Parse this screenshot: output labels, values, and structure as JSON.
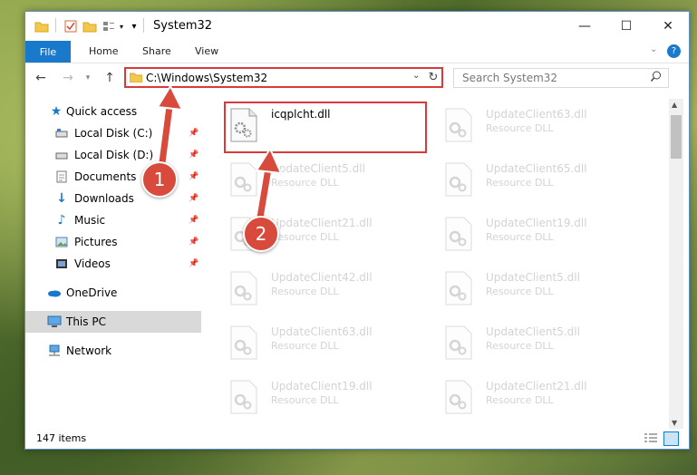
{
  "window": {
    "title": "System32"
  },
  "ribbon": {
    "file": "File",
    "tabs": [
      "Home",
      "Share",
      "View"
    ]
  },
  "address": {
    "path": "C:\\Windows\\System32"
  },
  "search": {
    "placeholder": "Search System32"
  },
  "sidebar": {
    "quick_access": "Quick access",
    "items": [
      {
        "label": "Local Disk (C:)",
        "icon": "drive-icon"
      },
      {
        "label": "Local Disk (D:)",
        "icon": "drive-icon"
      },
      {
        "label": "Documents",
        "icon": "documents-icon"
      },
      {
        "label": "Downloads",
        "icon": "downloads-icon"
      },
      {
        "label": "Music",
        "icon": "music-icon"
      },
      {
        "label": "Pictures",
        "icon": "pictures-icon"
      },
      {
        "label": "Videos",
        "icon": "videos-icon"
      }
    ],
    "onedrive": "OneDrive",
    "this_pc": "This PC",
    "network": "Network"
  },
  "files": [
    {
      "name": "icqplcht.dll",
      "type": ""
    },
    {
      "name": "UpdateClient63.dll",
      "type": "Resource DLL"
    },
    {
      "name": "UpdateClient5.dll",
      "type": "Resource DLL"
    },
    {
      "name": "UpdateClient65.dll",
      "type": "Resource DLL"
    },
    {
      "name": "UpdateClient21.dll",
      "type": "Resource DLL"
    },
    {
      "name": "UpdateClient19.dll",
      "type": "Resource DLL"
    },
    {
      "name": "UpdateClient42.dll",
      "type": "Resource DLL"
    },
    {
      "name": "UpdateClient5.dll",
      "type": "Resource DLL"
    },
    {
      "name": "UpdateClient63.dll",
      "type": "Resource DLL"
    },
    {
      "name": "UpdateClient5.dll",
      "type": "Resource DLL"
    },
    {
      "name": "UpdateClient19.dll",
      "type": "Resource DLL"
    },
    {
      "name": "UpdateClient21.dll",
      "type": "Resource DLL"
    }
  ],
  "annotations": {
    "badge1": "1",
    "badge2": "2"
  },
  "status": {
    "items": "147 items"
  },
  "colors": {
    "accent": "#1979ca",
    "highlight": "#d63a3a"
  }
}
